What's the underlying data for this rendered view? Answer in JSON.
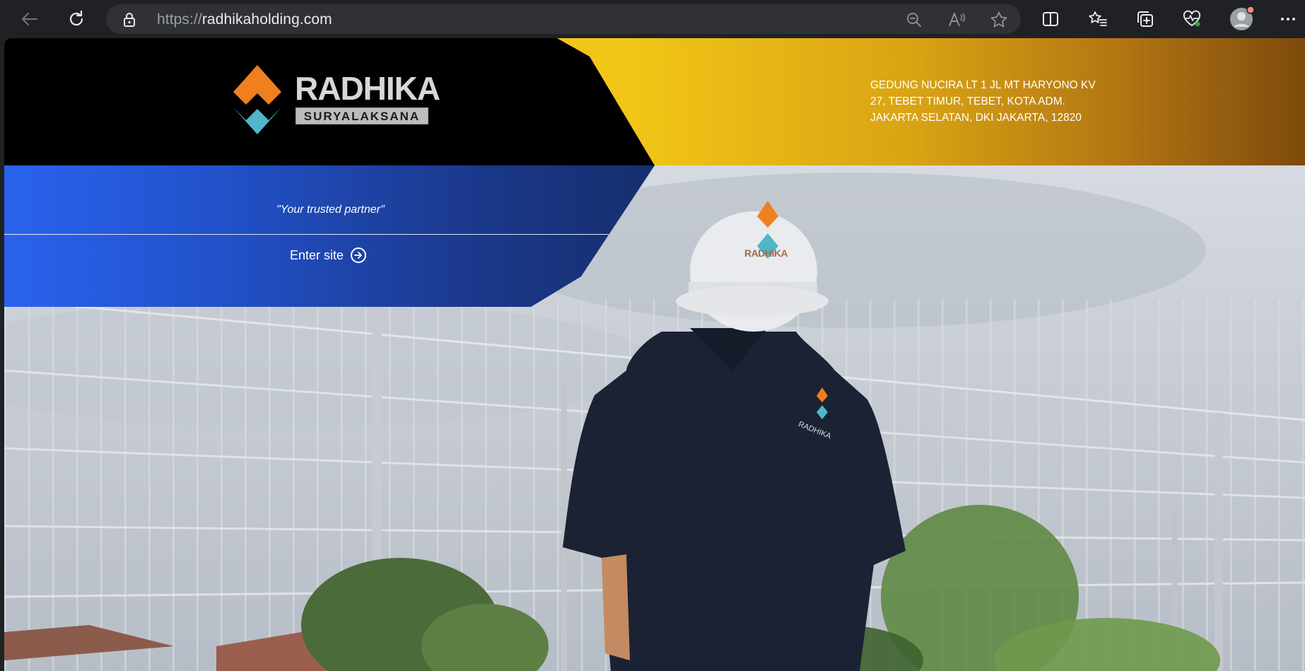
{
  "browser": {
    "url_protocol": "https://",
    "url_host": "radhikaholding.com",
    "icons": {
      "back": "back-arrow-icon",
      "refresh": "refresh-icon",
      "lock": "lock-icon",
      "zoom": "zoom-out-icon",
      "read_aloud": "read-aloud-icon",
      "favorite": "star-icon",
      "split": "split-screen-icon",
      "favorites": "favorites-icon",
      "collections": "collections-icon",
      "performance": "heartbeat-icon",
      "profile": "profile-avatar",
      "menu": "more-icon"
    }
  },
  "header": {
    "logo_word": "RADHIKA",
    "logo_sub": "SURYALAKSANA",
    "address_lines": [
      "GEDUNG NUCIRA LT 1 JL MT HARYONO KV",
      "27, TEBET TIMUR, TEBET, KOTA ADM.",
      "JAKARTA SELATAN, DKI JAKARTA, 12820"
    ]
  },
  "hero": {
    "tagline": "\"Your trusted partner\"",
    "enter_label": "Enter site",
    "helmet_word": "RADHIKA",
    "shirt_word": "RADHIKA"
  },
  "colors": {
    "gold": "#f6cc1a",
    "brown": "#7e4a0c",
    "blue": "#2a63ee",
    "navy": "#172e6e",
    "logo_orange": "#f07f1e",
    "logo_teal": "#4fb7c9"
  }
}
